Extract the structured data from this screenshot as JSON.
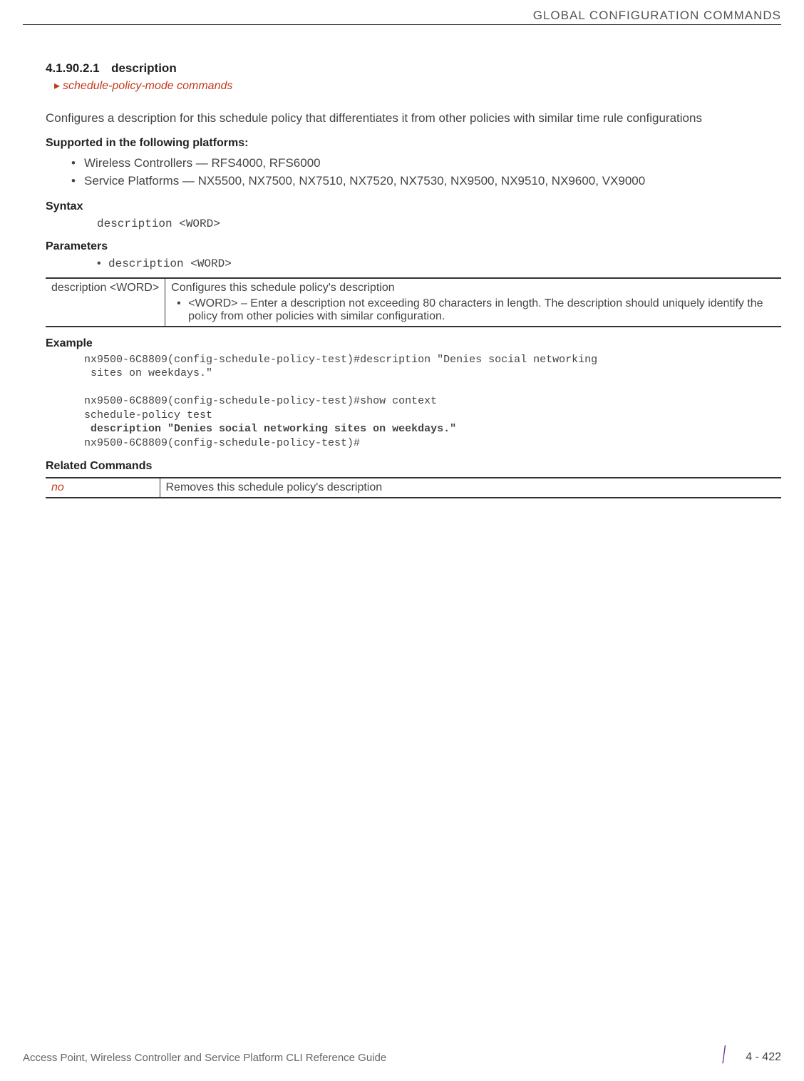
{
  "header": {
    "category": "GLOBAL CONFIGURATION COMMANDS"
  },
  "section": {
    "number": "4.1.90.2.1",
    "title": "description",
    "breadcrumb": "schedule-policy-mode commands",
    "intro": "Configures a description for this schedule policy that differentiates it from other policies with similar time rule configurations"
  },
  "supported": {
    "heading": "Supported in the following platforms:",
    "items": [
      "Wireless Controllers — RFS4000, RFS6000",
      "Service Platforms — NX5500, NX7500, NX7510, NX7520, NX7530, NX9500, NX9510, NX9600, VX9000"
    ]
  },
  "syntax": {
    "heading": "Syntax",
    "code": "description <WORD>"
  },
  "parameters": {
    "heading": "Parameters",
    "code": "description <WORD>",
    "table": {
      "row1_col1": "description <WORD>",
      "row1_col2": "Configures this schedule policy's description",
      "row1_bullet": "<WORD> – Enter a description not exceeding 80 characters in length. The description should uniquely identify the policy from other policies with similar configuration."
    }
  },
  "example": {
    "heading": "Example",
    "line1": "nx9500-6C8809(config-schedule-policy-test)#description \"Denies social networking",
    "line2": " sites on weekdays.\"",
    "line3": "nx9500-6C8809(config-schedule-policy-test)#show context",
    "line4": "schedule-policy test",
    "line5": " description \"Denies social networking sites on weekdays.\"",
    "line6": "nx9500-6C8809(config-schedule-policy-test)#"
  },
  "related": {
    "heading": "Related Commands",
    "table": {
      "command": "no",
      "description": "Removes this schedule policy's description"
    }
  },
  "footer": {
    "text": "Access Point, Wireless Controller and Service Platform CLI Reference Guide",
    "page": "4 - 422"
  }
}
